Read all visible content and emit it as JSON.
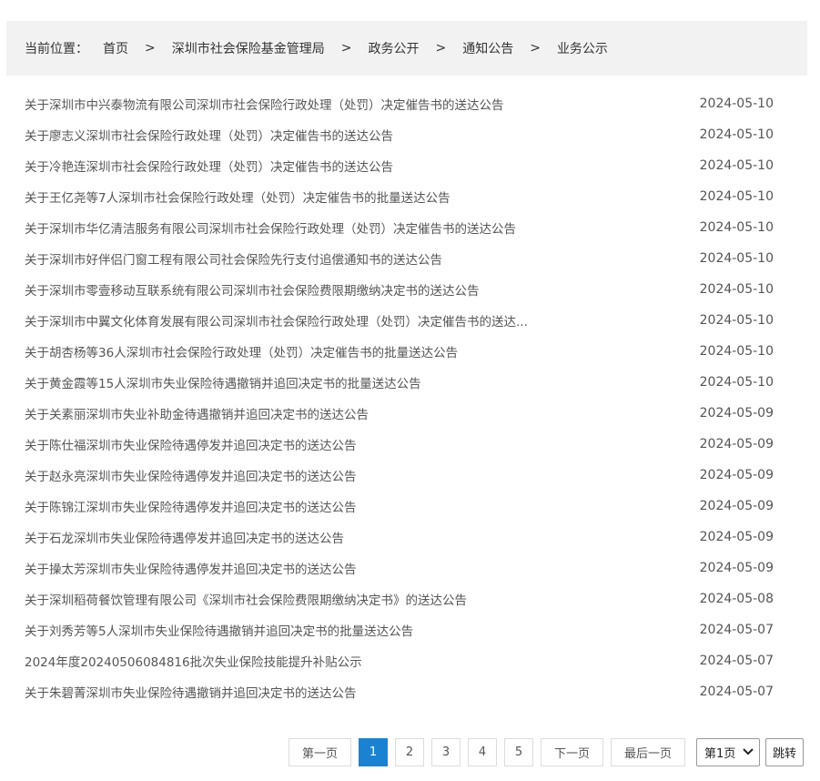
{
  "breadcrumb": {
    "prefix": "当前位置：",
    "items": [
      "首页",
      "深圳市社会保险基金管理局",
      "政务公开",
      "通知公告",
      "业务公示"
    ],
    "separator": ">"
  },
  "notices": [
    {
      "title": "关于深圳市中兴泰物流有限公司深圳市社会保险行政处理（处罚）决定催告书的送达公告",
      "date": "2024-05-10"
    },
    {
      "title": "关于廖志义深圳市社会保险行政处理（处罚）决定催告书的送达公告",
      "date": "2024-05-10"
    },
    {
      "title": "关于冷艳连深圳市社会保险行政处理（处罚）决定催告书的送达公告",
      "date": "2024-05-10"
    },
    {
      "title": "关于王亿尧等7人深圳市社会保险行政处理（处罚）决定催告书的批量送达公告",
      "date": "2024-05-10"
    },
    {
      "title": "关于深圳市华亿清洁服务有限公司深圳市社会保险行政处理（处罚）决定催告书的送达公告",
      "date": "2024-05-10"
    },
    {
      "title": "关于深圳市好伴侣门窗工程有限公司社会保险先行支付追偿通知书的送达公告",
      "date": "2024-05-10"
    },
    {
      "title": "关于深圳市零壹移动互联系统有限公司深圳市社会保险费限期缴纳决定书的送达公告",
      "date": "2024-05-10"
    },
    {
      "title": "关于深圳市中翼文化体育发展有限公司深圳市社会保险行政处理（处罚）决定催告书的送达...",
      "date": "2024-05-10"
    },
    {
      "title": "关于胡杏杨等36人深圳市社会保险行政处理（处罚）决定催告书的批量送达公告",
      "date": "2024-05-10"
    },
    {
      "title": "关于黄金霞等15人深圳市失业保险待遇撤销并追回决定书的批量送达公告",
      "date": "2024-05-10"
    },
    {
      "title": "关于关素丽深圳市失业补助金待遇撤销并追回决定书的送达公告",
      "date": "2024-05-09"
    },
    {
      "title": "关于陈仕福深圳市失业保险待遇停发并追回决定书的送达公告",
      "date": "2024-05-09"
    },
    {
      "title": "关于赵永亮深圳市失业保险待遇停发并追回决定书的送达公告",
      "date": "2024-05-09"
    },
    {
      "title": "关于陈锦江深圳市失业保险待遇停发并追回决定书的送达公告",
      "date": "2024-05-09"
    },
    {
      "title": "关于石龙深圳市失业保险待遇停发并追回决定书的送达公告",
      "date": "2024-05-09"
    },
    {
      "title": "关于操太芳深圳市失业保险待遇停发并追回决定书的送达公告",
      "date": "2024-05-09"
    },
    {
      "title": "关于深圳稻荷餐饮管理有限公司《深圳市社会保险费限期缴纳决定书》的送达公告",
      "date": "2024-05-08"
    },
    {
      "title": "关于刘秀芳等5人深圳市失业保险待遇撤销并追回决定书的批量送达公告",
      "date": "2024-05-07"
    },
    {
      "title": "2024年度20240506084816批次失业保险技能提升补贴公示",
      "date": "2024-05-07"
    },
    {
      "title": "关于朱碧菁深圳市失业保险待遇撤销并追回决定书的送达公告",
      "date": "2024-05-07"
    }
  ],
  "pagination": {
    "first": "第一页",
    "pages": [
      "1",
      "2",
      "3",
      "4",
      "5"
    ],
    "current_page": "1",
    "next": "下一页",
    "last": "最后一页",
    "select_value": "第1页",
    "go": "跳转",
    "active_color": "#1b82d1"
  }
}
